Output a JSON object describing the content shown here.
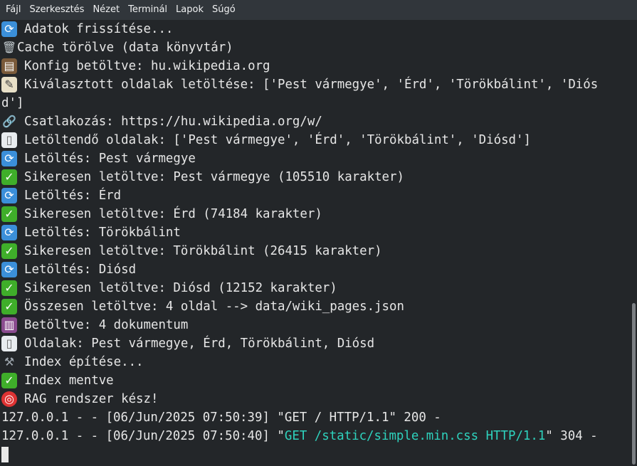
{
  "menu": [
    "Fájl",
    "Szerkesztés",
    "Nézet",
    "Terminál",
    "Lapok",
    "Súgó"
  ],
  "lines": [
    {
      "icon": "refresh-icon",
      "text": "Adatok frissítése..."
    },
    {
      "icon": "trash-icon",
      "text": "Cache törölve (data könyvtár)"
    },
    {
      "icon": "clipboard-icon",
      "text": "Konfig betöltve: hu.wikipedia.org"
    },
    {
      "icon": "memo-icon",
      "text": "Kiválasztott oldalak letöltése: ['Pest vármegye', 'Érd', 'Törökbálint', 'Diós"
    },
    {
      "icon": "",
      "text": "d']"
    },
    {
      "icon": "link-icon",
      "text": "Csatlakozás: https://hu.wikipedia.org/w/"
    },
    {
      "icon": "page-icon",
      "text": "Letöltendő oldalak: ['Pest vármegye', 'Érd', 'Törökbálint', 'Diósd']"
    },
    {
      "icon": "refresh-icon",
      "text": "Letöltés: Pest vármegye"
    },
    {
      "icon": "check-icon",
      "text": "Sikeresen letöltve: Pest vármegye (105510 karakter)"
    },
    {
      "icon": "refresh-icon",
      "text": "Letöltés: Érd"
    },
    {
      "icon": "check-icon",
      "text": "Sikeresen letöltve: Érd (74184 karakter)"
    },
    {
      "icon": "refresh-icon",
      "text": "Letöltés: Törökbálint"
    },
    {
      "icon": "check-icon",
      "text": "Sikeresen letöltve: Törökbálint (26415 karakter)"
    },
    {
      "icon": "refresh-icon",
      "text": "Letöltés: Diósd"
    },
    {
      "icon": "check-icon",
      "text": "Sikeresen letöltve: Diósd (12152 karakter)"
    },
    {
      "icon": "check-icon",
      "text": "Összesen letöltve: 4 oldal --> data/wiki_pages.json"
    },
    {
      "icon": "books-icon",
      "text": "Betöltve: 4 dokumentum"
    },
    {
      "icon": "page-icon",
      "text": "Oldalak: Pest vármegye, Érd, Törökbálint, Diósd"
    },
    {
      "icon": "hammer-icon",
      "text": "Index építése..."
    },
    {
      "icon": "check-icon",
      "text": "Index mentve"
    },
    {
      "icon": "target-icon",
      "text": "RAG rendszer kész!"
    }
  ],
  "log1": "127.0.0.1 - - [06/Jun/2025 07:50:39] \"GET / HTTP/1.1\" 200 -",
  "log2": {
    "prefix": "127.0.0.1 - - [06/Jun/2025 07:50:40] \"",
    "highlight": "GET /static/simple.min.css HTTP/1.1",
    "suffix": "\" 304 -"
  },
  "colors": {
    "background": "#232629",
    "highlight": "#2ed2bd",
    "menubar": "#31363b"
  }
}
